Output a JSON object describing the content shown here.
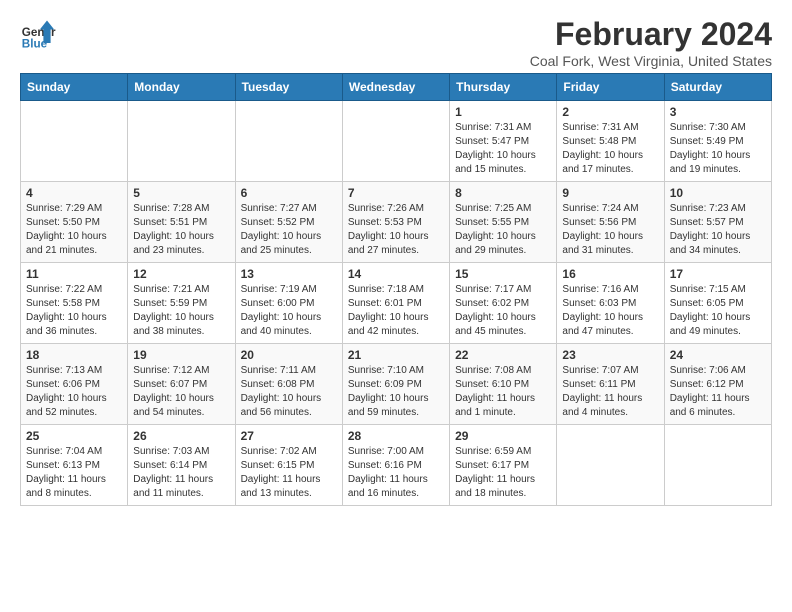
{
  "logo": {
    "line1": "General",
    "line2": "Blue"
  },
  "title": "February 2024",
  "location": "Coal Fork, West Virginia, United States",
  "days_of_week": [
    "Sunday",
    "Monday",
    "Tuesday",
    "Wednesday",
    "Thursday",
    "Friday",
    "Saturday"
  ],
  "weeks": [
    [
      {
        "day": "",
        "info": ""
      },
      {
        "day": "",
        "info": ""
      },
      {
        "day": "",
        "info": ""
      },
      {
        "day": "",
        "info": ""
      },
      {
        "day": "1",
        "info": "Sunrise: 7:31 AM\nSunset: 5:47 PM\nDaylight: 10 hours\nand 15 minutes."
      },
      {
        "day": "2",
        "info": "Sunrise: 7:31 AM\nSunset: 5:48 PM\nDaylight: 10 hours\nand 17 minutes."
      },
      {
        "day": "3",
        "info": "Sunrise: 7:30 AM\nSunset: 5:49 PM\nDaylight: 10 hours\nand 19 minutes."
      }
    ],
    [
      {
        "day": "4",
        "info": "Sunrise: 7:29 AM\nSunset: 5:50 PM\nDaylight: 10 hours\nand 21 minutes."
      },
      {
        "day": "5",
        "info": "Sunrise: 7:28 AM\nSunset: 5:51 PM\nDaylight: 10 hours\nand 23 minutes."
      },
      {
        "day": "6",
        "info": "Sunrise: 7:27 AM\nSunset: 5:52 PM\nDaylight: 10 hours\nand 25 minutes."
      },
      {
        "day": "7",
        "info": "Sunrise: 7:26 AM\nSunset: 5:53 PM\nDaylight: 10 hours\nand 27 minutes."
      },
      {
        "day": "8",
        "info": "Sunrise: 7:25 AM\nSunset: 5:55 PM\nDaylight: 10 hours\nand 29 minutes."
      },
      {
        "day": "9",
        "info": "Sunrise: 7:24 AM\nSunset: 5:56 PM\nDaylight: 10 hours\nand 31 minutes."
      },
      {
        "day": "10",
        "info": "Sunrise: 7:23 AM\nSunset: 5:57 PM\nDaylight: 10 hours\nand 34 minutes."
      }
    ],
    [
      {
        "day": "11",
        "info": "Sunrise: 7:22 AM\nSunset: 5:58 PM\nDaylight: 10 hours\nand 36 minutes."
      },
      {
        "day": "12",
        "info": "Sunrise: 7:21 AM\nSunset: 5:59 PM\nDaylight: 10 hours\nand 38 minutes."
      },
      {
        "day": "13",
        "info": "Sunrise: 7:19 AM\nSunset: 6:00 PM\nDaylight: 10 hours\nand 40 minutes."
      },
      {
        "day": "14",
        "info": "Sunrise: 7:18 AM\nSunset: 6:01 PM\nDaylight: 10 hours\nand 42 minutes."
      },
      {
        "day": "15",
        "info": "Sunrise: 7:17 AM\nSunset: 6:02 PM\nDaylight: 10 hours\nand 45 minutes."
      },
      {
        "day": "16",
        "info": "Sunrise: 7:16 AM\nSunset: 6:03 PM\nDaylight: 10 hours\nand 47 minutes."
      },
      {
        "day": "17",
        "info": "Sunrise: 7:15 AM\nSunset: 6:05 PM\nDaylight: 10 hours\nand 49 minutes."
      }
    ],
    [
      {
        "day": "18",
        "info": "Sunrise: 7:13 AM\nSunset: 6:06 PM\nDaylight: 10 hours\nand 52 minutes."
      },
      {
        "day": "19",
        "info": "Sunrise: 7:12 AM\nSunset: 6:07 PM\nDaylight: 10 hours\nand 54 minutes."
      },
      {
        "day": "20",
        "info": "Sunrise: 7:11 AM\nSunset: 6:08 PM\nDaylight: 10 hours\nand 56 minutes."
      },
      {
        "day": "21",
        "info": "Sunrise: 7:10 AM\nSunset: 6:09 PM\nDaylight: 10 hours\nand 59 minutes."
      },
      {
        "day": "22",
        "info": "Sunrise: 7:08 AM\nSunset: 6:10 PM\nDaylight: 11 hours\nand 1 minute."
      },
      {
        "day": "23",
        "info": "Sunrise: 7:07 AM\nSunset: 6:11 PM\nDaylight: 11 hours\nand 4 minutes."
      },
      {
        "day": "24",
        "info": "Sunrise: 7:06 AM\nSunset: 6:12 PM\nDaylight: 11 hours\nand 6 minutes."
      }
    ],
    [
      {
        "day": "25",
        "info": "Sunrise: 7:04 AM\nSunset: 6:13 PM\nDaylight: 11 hours\nand 8 minutes."
      },
      {
        "day": "26",
        "info": "Sunrise: 7:03 AM\nSunset: 6:14 PM\nDaylight: 11 hours\nand 11 minutes."
      },
      {
        "day": "27",
        "info": "Sunrise: 7:02 AM\nSunset: 6:15 PM\nDaylight: 11 hours\nand 13 minutes."
      },
      {
        "day": "28",
        "info": "Sunrise: 7:00 AM\nSunset: 6:16 PM\nDaylight: 11 hours\nand 16 minutes."
      },
      {
        "day": "29",
        "info": "Sunrise: 6:59 AM\nSunset: 6:17 PM\nDaylight: 11 hours\nand 18 minutes."
      },
      {
        "day": "",
        "info": ""
      },
      {
        "day": "",
        "info": ""
      }
    ]
  ]
}
